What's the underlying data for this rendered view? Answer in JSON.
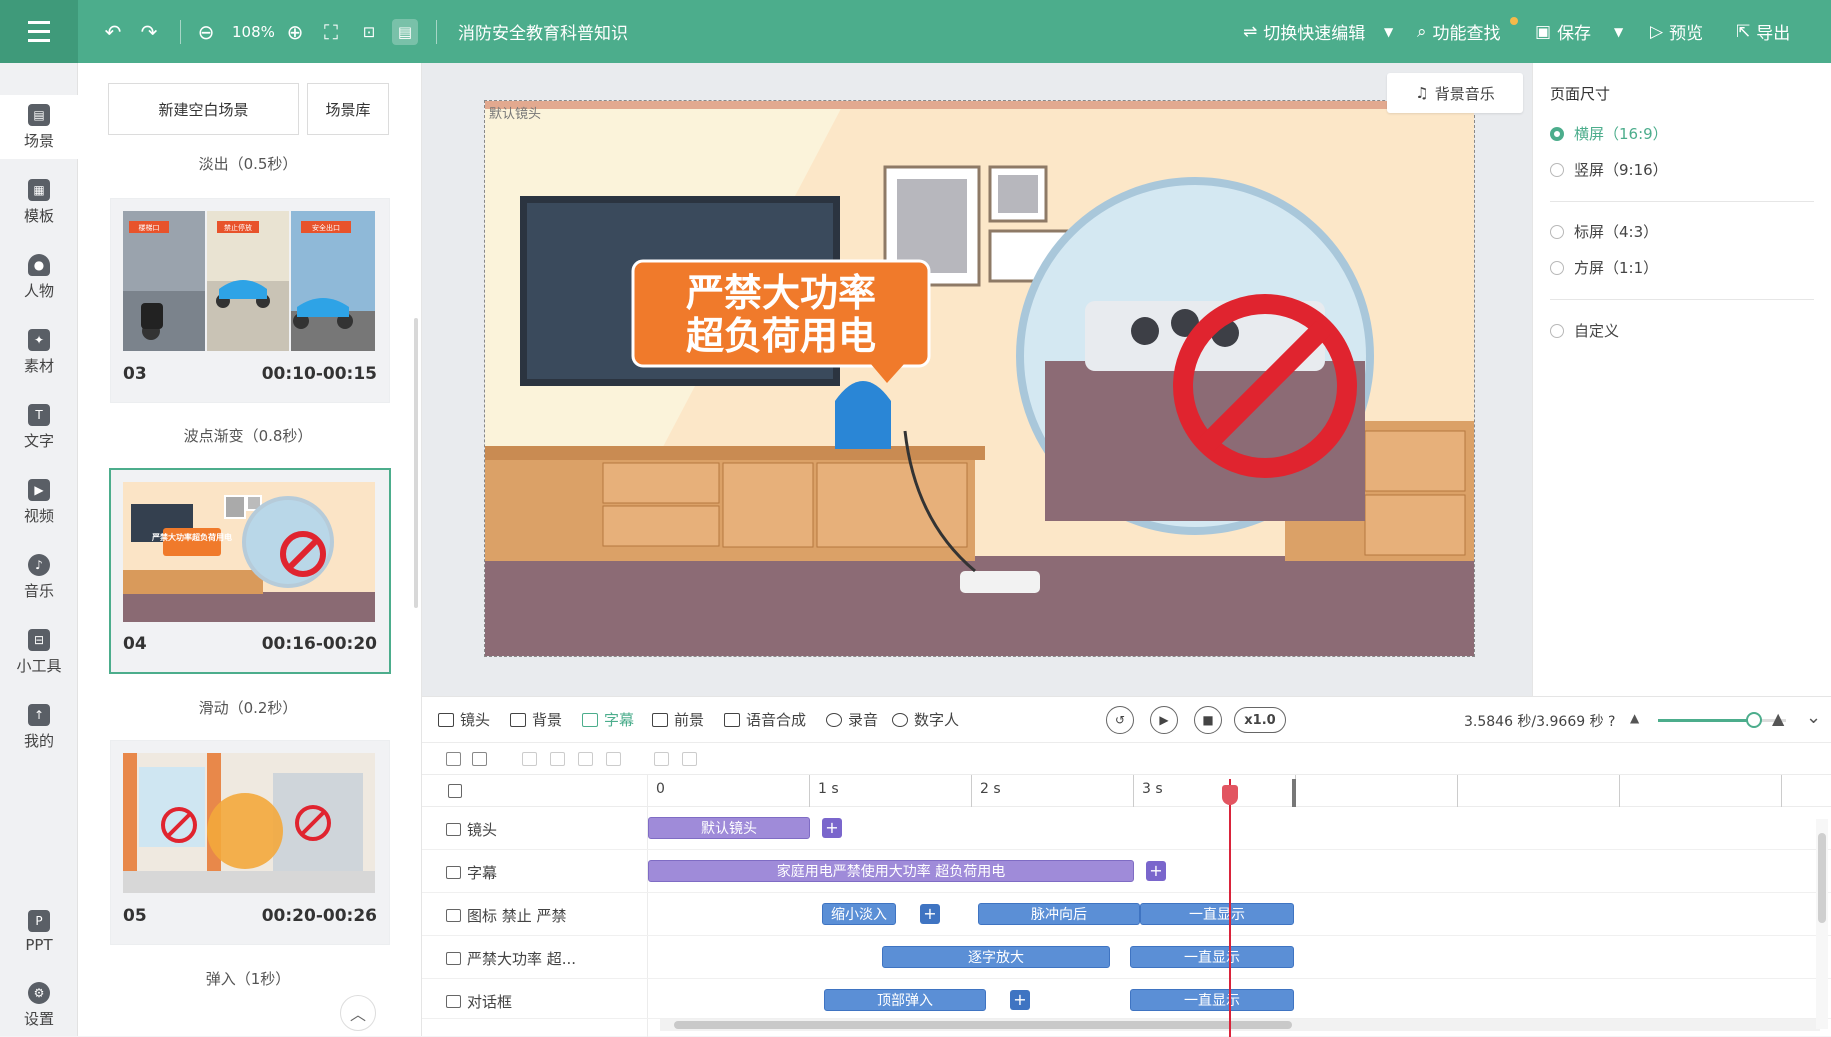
{
  "topbar": {
    "zoom": "108%",
    "project_title": "消防安全教育科普知识",
    "switch_edit": "切换快速编辑",
    "func_search": "功能查找",
    "save": "保存",
    "preview": "预览",
    "export": "导出"
  },
  "rail": {
    "items": [
      {
        "label": "场景",
        "icon": "scene-icon"
      },
      {
        "label": "模板",
        "icon": "template-icon"
      },
      {
        "label": "人物",
        "icon": "person-icon"
      },
      {
        "label": "素材",
        "icon": "material-icon"
      },
      {
        "label": "文字",
        "icon": "text-icon"
      },
      {
        "label": "视频",
        "icon": "video-icon"
      },
      {
        "label": "音乐",
        "icon": "music-icon"
      },
      {
        "label": "小工具",
        "icon": "toolbox-icon"
      },
      {
        "label": "我的",
        "icon": "upload-icon"
      },
      {
        "label": "PPT",
        "icon": "ppt-icon"
      },
      {
        "label": "设置",
        "icon": "gear-icon"
      }
    ]
  },
  "scenes": {
    "new_blank": "新建空白场景",
    "library": "场景库",
    "transitions": [
      "淡出（0.5秒）",
      "波点渐变（0.8秒）",
      "滑动（0.2秒）",
      "弹入（1秒）"
    ],
    "cards": [
      {
        "num": "03",
        "time": "00:10-00:15"
      },
      {
        "num": "04",
        "time": "00:16-00:20"
      },
      {
        "num": "05",
        "time": "00:20-00:26"
      }
    ],
    "thumb03_signs": [
      "楼梯口",
      "禁止停放",
      "安全出口"
    ],
    "thumb04_sign": "严禁大功率超负荷用电"
  },
  "stage": {
    "bgm": "背景音乐",
    "canvas_label": "默认镜头",
    "sign_line1": "严禁大功率",
    "sign_line2": "超负荷用电"
  },
  "rpanel": {
    "title": "页面尺寸",
    "options": [
      "横屏（16:9）",
      "竖屏（9:16）",
      "标屏（4:3）",
      "方屏（1:1）",
      "自定义"
    ],
    "selected": "横屏（16:9）"
  },
  "timeline": {
    "tabs": [
      "镜头",
      "背景",
      "字幕",
      "前景",
      "语音合成",
      "录音",
      "数字人"
    ],
    "active_tab": "字幕",
    "speed": "x1.0",
    "time": "3.5846 秒/3.9669 秒",
    "ruler": [
      "0",
      "1 s",
      "2 s",
      "3 s"
    ],
    "tracks": [
      {
        "label": "镜头",
        "clips": [
          "默认镜头"
        ]
      },
      {
        "label": "字幕",
        "clips": [
          "家庭用电严禁使用大功率 超负荷用电"
        ]
      },
      {
        "label": "图标 禁止 严禁",
        "clips": [
          "缩小淡入",
          "脉冲向后",
          "一直显示"
        ]
      },
      {
        "label": "严禁大功率 超...",
        "clips": [
          "逐字放大",
          "一直显示"
        ]
      },
      {
        "label": "对话框",
        "clips": [
          "顶部弹入",
          "一直显示"
        ]
      }
    ]
  },
  "colors": {
    "brand": "#4cad8c",
    "clip_purple": "#9f8bd9",
    "clip_blue": "#5b8fd6",
    "playhead": "#d9233a",
    "sign_orange": "#f07a2b"
  }
}
